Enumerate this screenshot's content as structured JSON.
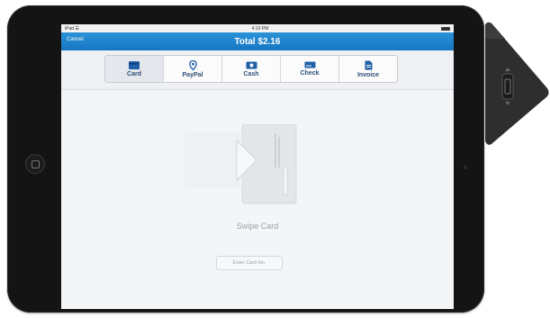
{
  "statusbar": {
    "carrier": "iPad ☰",
    "time": "4:10 PM"
  },
  "navbar": {
    "cancel_label": "Cancel",
    "title": "Total $2.16"
  },
  "tabs": [
    {
      "label": "Card",
      "icon": "card-icon",
      "active": true
    },
    {
      "label": "PayPal",
      "icon": "paypal-pin-icon",
      "active": false
    },
    {
      "label": "Cash",
      "icon": "cash-icon",
      "active": false
    },
    {
      "label": "Check",
      "icon": "check-icon",
      "active": false
    },
    {
      "label": "Invoice",
      "icon": "invoice-icon",
      "active": false
    }
  ],
  "content": {
    "swipe_label": "Swipe Card",
    "enter_card_label": "Enter Card No."
  },
  "colors": {
    "nav_blue": "#1a7ccc",
    "tab_text": "#2e4f7a",
    "icon_blue": "#1f5fa8",
    "device_black": "#141414"
  }
}
